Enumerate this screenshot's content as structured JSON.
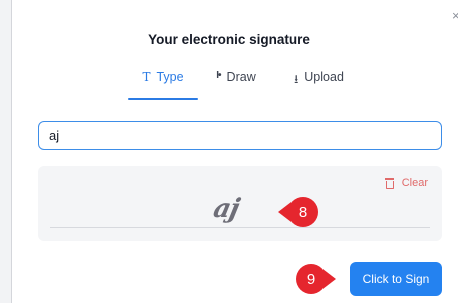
{
  "dialog": {
    "title": "Your electronic signature",
    "close_glyph": "×"
  },
  "tabs": [
    {
      "label": "Type",
      "icon": "text-type-icon",
      "active": true
    },
    {
      "label": "Draw",
      "icon": "pen-draw-icon",
      "active": false
    },
    {
      "label": "Upload",
      "icon": "upload-icon",
      "active": false
    }
  ],
  "signature_input": {
    "value": "aj"
  },
  "preview": {
    "clear_label": "Clear",
    "signature_text": "aj"
  },
  "annotations": {
    "step_8": "8",
    "step_9": "9"
  },
  "actions": {
    "sign_label": "Click to Sign"
  },
  "colors": {
    "accent": "#2b7be4",
    "button": "#2482f0",
    "clear": "#e06a6a",
    "annotation": "#e5262e"
  }
}
